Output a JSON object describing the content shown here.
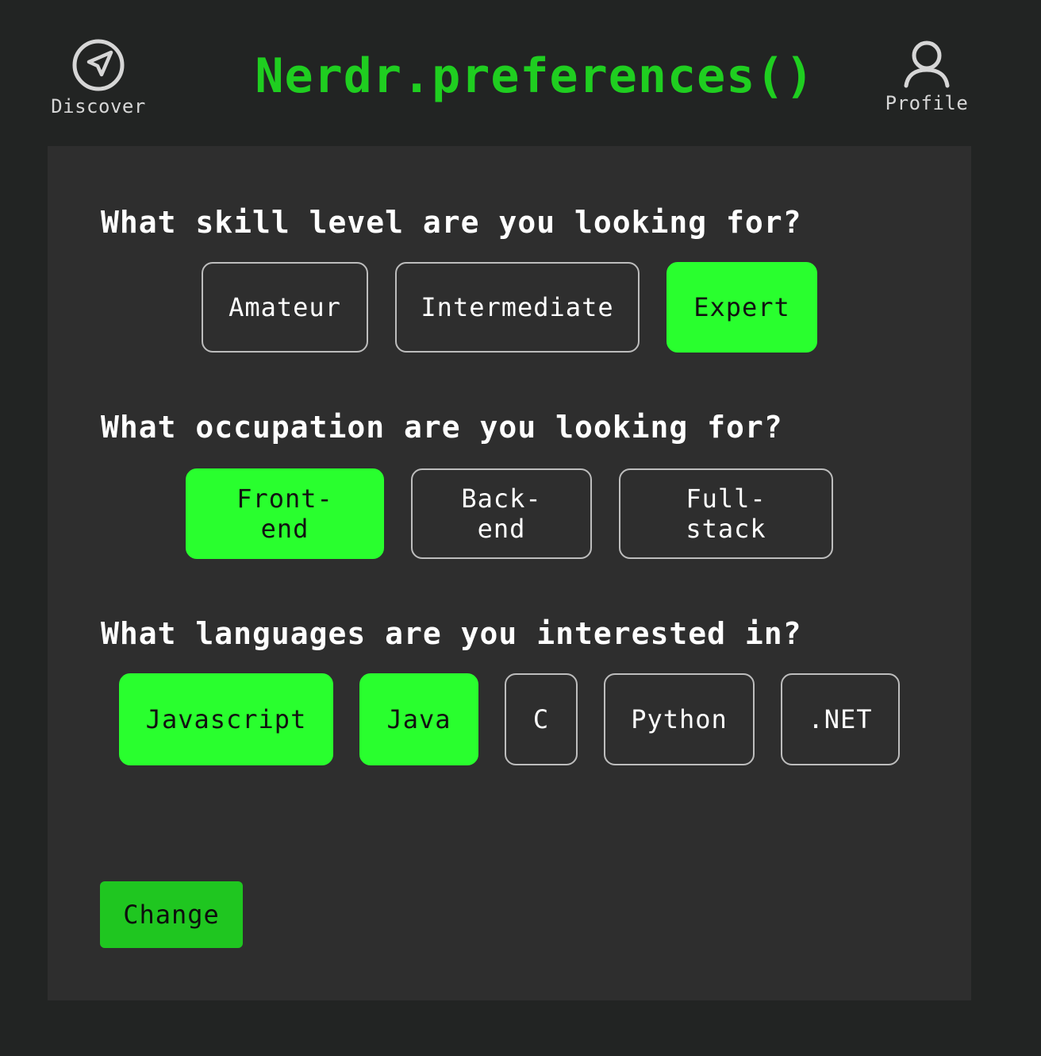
{
  "header": {
    "title": "Nerdr.preferences()",
    "discover": {
      "label": "Discover",
      "icon": "compass-icon"
    },
    "profile": {
      "label": "Profile",
      "icon": "user-icon"
    }
  },
  "colors": {
    "background": "#222423",
    "panel": "#2e2e2e",
    "accent": "#29ff2e",
    "title": "#1fce20",
    "button": "#1fc620"
  },
  "questions": [
    {
      "text": "What skill level are you looking for?",
      "options": [
        {
          "label": "Amateur",
          "selected": false
        },
        {
          "label": "Intermediate",
          "selected": false
        },
        {
          "label": "Expert",
          "selected": true
        }
      ]
    },
    {
      "text": "What occupation are you looking for?",
      "options": [
        {
          "label": "Front-end",
          "selected": true
        },
        {
          "label": "Back-end",
          "selected": false
        },
        {
          "label": "Full-stack",
          "selected": false
        }
      ]
    },
    {
      "text": "What languages are you interested in?",
      "options": [
        {
          "label": "Javascript",
          "selected": true
        },
        {
          "label": "Java",
          "selected": true
        },
        {
          "label": "C",
          "selected": false
        },
        {
          "label": "Python",
          "selected": false
        },
        {
          "label": ".NET",
          "selected": false
        }
      ]
    }
  ],
  "actions": {
    "change_label": "Change"
  }
}
